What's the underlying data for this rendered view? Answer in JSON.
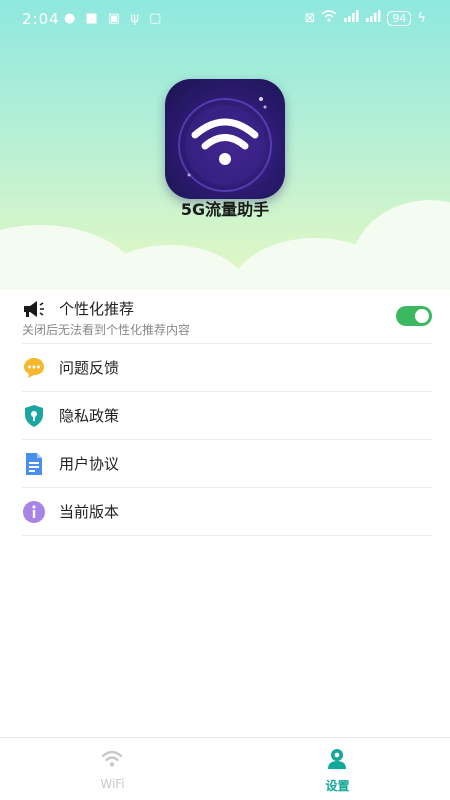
{
  "status_bar": {
    "time": "2:04",
    "notification_icons": [
      "qq-icon",
      "wechat-icon",
      "image-icon",
      "usb-icon",
      "message-icon"
    ],
    "battery": "94"
  },
  "app": {
    "name": "5G流量助手",
    "icon": "wifi-icon"
  },
  "settings": {
    "personalized": {
      "label": "个性化推荐",
      "description": "关闭后无法看到个性化推荐内容",
      "icon": "megaphone-icon",
      "enabled": true
    },
    "items": [
      {
        "label": "问题反馈",
        "icon": "chat-bubble-icon",
        "color": "#f5b82e"
      },
      {
        "label": "隐私政策",
        "icon": "shield-icon",
        "color": "#1aa6a0"
      },
      {
        "label": "用户协议",
        "icon": "document-icon",
        "color": "#4a8ff0"
      },
      {
        "label": "当前版本",
        "icon": "info-icon",
        "color": "#a884e6"
      }
    ]
  },
  "tabbar": {
    "tabs": [
      {
        "label": "WiFi",
        "icon": "wifi-icon",
        "active": false
      },
      {
        "label": "设置",
        "icon": "user-icon",
        "active": true
      }
    ],
    "active_color": "#12a89a",
    "inactive_color": "#c8c8c8"
  },
  "colors": {
    "toggle_on": "#3cb860",
    "hero_top": "#8fe8df",
    "hero_bottom": "#e6f8c3"
  }
}
